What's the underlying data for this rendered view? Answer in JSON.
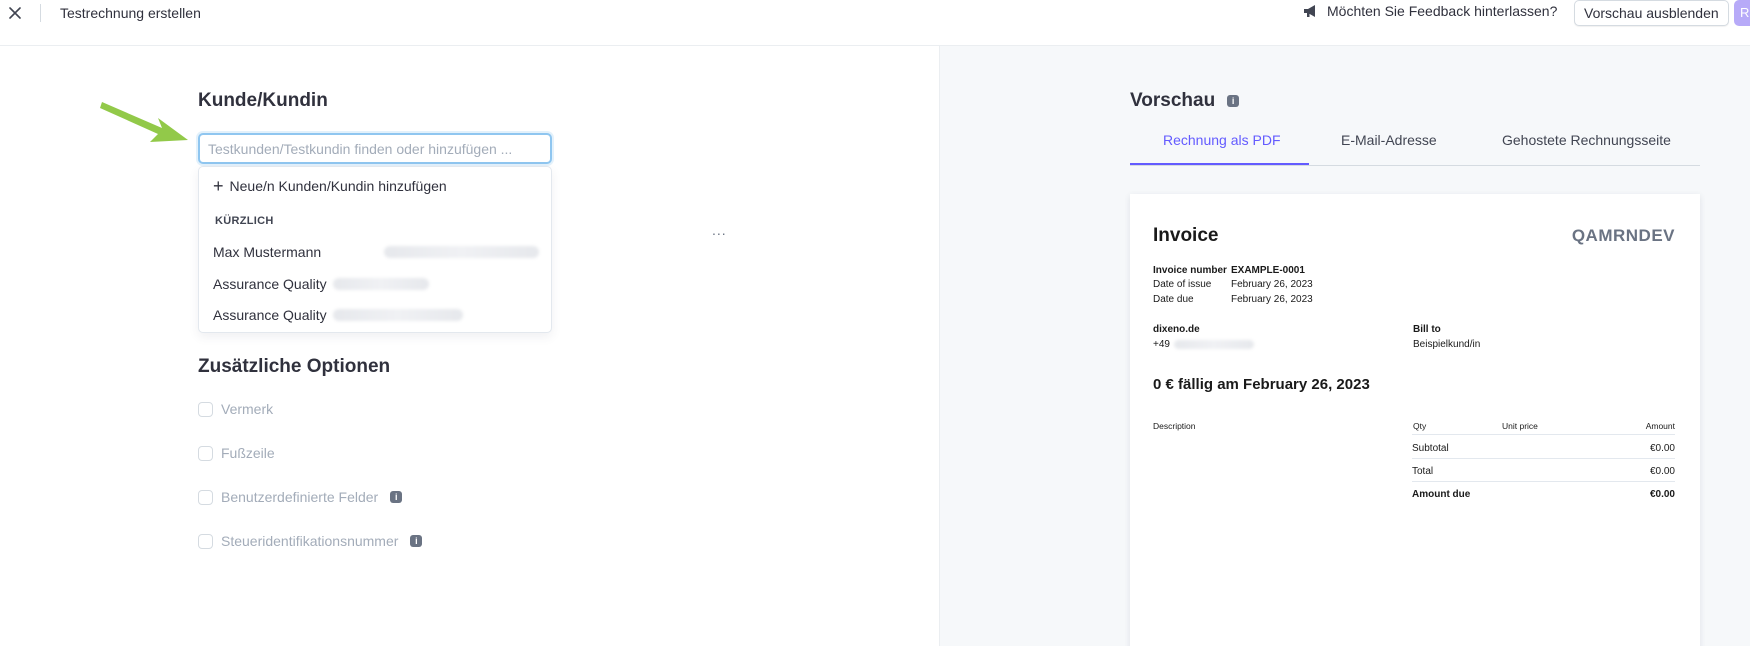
{
  "header": {
    "title": "Testrechnung erstellen",
    "feedback_label": "Möchten Sie Feedback hinterlassen?",
    "hide_preview_label": "Vorschau ausblenden",
    "primary_button_stub": "R"
  },
  "customer": {
    "section_title": "Kunde/Kundin",
    "input_placeholder": "Testkunden/Testkundin finden oder hinzufügen ...",
    "dropdown": {
      "add_label": "Neue/n Kunden/Kundin hinzufügen",
      "recent_label": "KÜRZLICH",
      "items": [
        {
          "name": "Max Mustermann"
        },
        {
          "name": "Assurance Quality"
        },
        {
          "name": "Assurance Quality"
        }
      ]
    },
    "more_label": "..."
  },
  "options": {
    "section_title": "Zusätzliche Optionen",
    "items": [
      {
        "label": "Vermerk",
        "info": false
      },
      {
        "label": "Fußzeile",
        "info": false
      },
      {
        "label": "Benutzerdefinierte Felder",
        "info": true
      },
      {
        "label": "Steueridentifikationsnummer",
        "info": true
      }
    ]
  },
  "preview": {
    "title": "Vorschau",
    "tabs": [
      {
        "label": "Rechnung als PDF",
        "active": true
      },
      {
        "label": "E-Mail-Adresse",
        "active": false
      },
      {
        "label": "Gehostete Rechnungsseite",
        "active": false
      }
    ],
    "invoice": {
      "title": "Invoice",
      "company": "QAMRNDEV",
      "number_label": "Invoice number",
      "number_value": "EXAMPLE-0001",
      "issue_label": "Date of issue",
      "issue_value": "February 26, 2023",
      "due_label": "Date due",
      "due_value": "February 26, 2023",
      "from_name": "dixeno.de",
      "from_phone": "+49",
      "bill_to_label": "Bill to",
      "bill_to_value": "Beispielkund/in",
      "due_heading": "0 € fällig am February 26, 2023",
      "col_description": "Description",
      "col_qty": "Qty",
      "col_unit_price": "Unit price",
      "col_amount": "Amount",
      "subtotal_label": "Subtotal",
      "subtotal_value": "€0.00",
      "total_label": "Total",
      "total_value": "€0.00",
      "amount_due_label": "Amount due",
      "amount_due_value": "€0.00"
    }
  },
  "colors": {
    "accent": "#635bff",
    "focus_ring": "#8fc6f0",
    "arrow": "#8cc63f"
  }
}
